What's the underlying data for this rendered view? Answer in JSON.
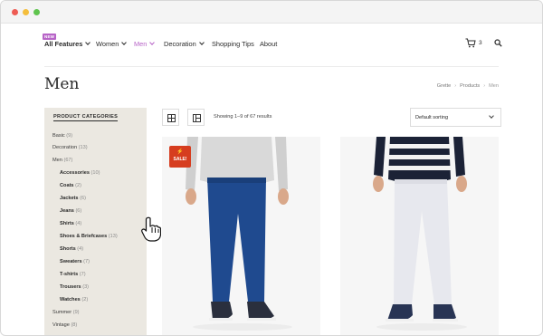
{
  "window": {
    "controls": [
      "close",
      "minimize",
      "maximize"
    ]
  },
  "nav": {
    "new_badge": "NEW",
    "items": [
      {
        "label": "All Features"
      },
      {
        "label": "Women"
      },
      {
        "label": "Men"
      },
      {
        "label": "Decoration"
      },
      {
        "label": "Shopping Tips"
      },
      {
        "label": "About"
      }
    ],
    "cart_count": "3",
    "icons": {
      "cart": "cart-icon",
      "search": "search-icon"
    }
  },
  "page": {
    "title": "Men",
    "breadcrumb": [
      "Grette",
      "Products",
      "Men"
    ]
  },
  "sidebar": {
    "heading": "PRODUCT CATEGORIES",
    "categories": [
      {
        "label": "Basic",
        "count": "(9)"
      },
      {
        "label": "Decoration",
        "count": "(13)"
      },
      {
        "label": "Men",
        "count": "(67)"
      },
      {
        "label": "Accessories",
        "count": "(10)"
      },
      {
        "label": "Coats",
        "count": "(2)"
      },
      {
        "label": "Jackets",
        "count": "(6)"
      },
      {
        "label": "Jeans",
        "count": "(6)"
      },
      {
        "label": "Shirts",
        "count": "(4)"
      },
      {
        "label": "Shoes & Briefcases",
        "count": "(13)"
      },
      {
        "label": "Shorts",
        "count": "(4)"
      },
      {
        "label": "Sweaters",
        "count": "(7)"
      },
      {
        "label": "T-shirts",
        "count": "(7)"
      },
      {
        "label": "Trousers",
        "count": "(3)"
      },
      {
        "label": "Watches",
        "count": "(2)"
      },
      {
        "label": "Summer",
        "count": "(9)"
      },
      {
        "label": "Vintage",
        "count": "(8)"
      }
    ]
  },
  "toolbar": {
    "showing": "Showing 1–9 of 67 results",
    "sort_label": "Default sorting",
    "view_icons": [
      "grid-view-icon",
      "list-view-icon"
    ]
  },
  "products": [
    {
      "badge": "SALE!",
      "trousers_color": "#1f4a8f",
      "top_color": "#d9d9d9"
    },
    {
      "trousers_color": "#e7e8ee",
      "top_color": "#1b2236"
    }
  ],
  "colors": {
    "accent": "#b764c7",
    "sale": "#d63d1f",
    "sidebar_bg": "#ebe8e1"
  }
}
